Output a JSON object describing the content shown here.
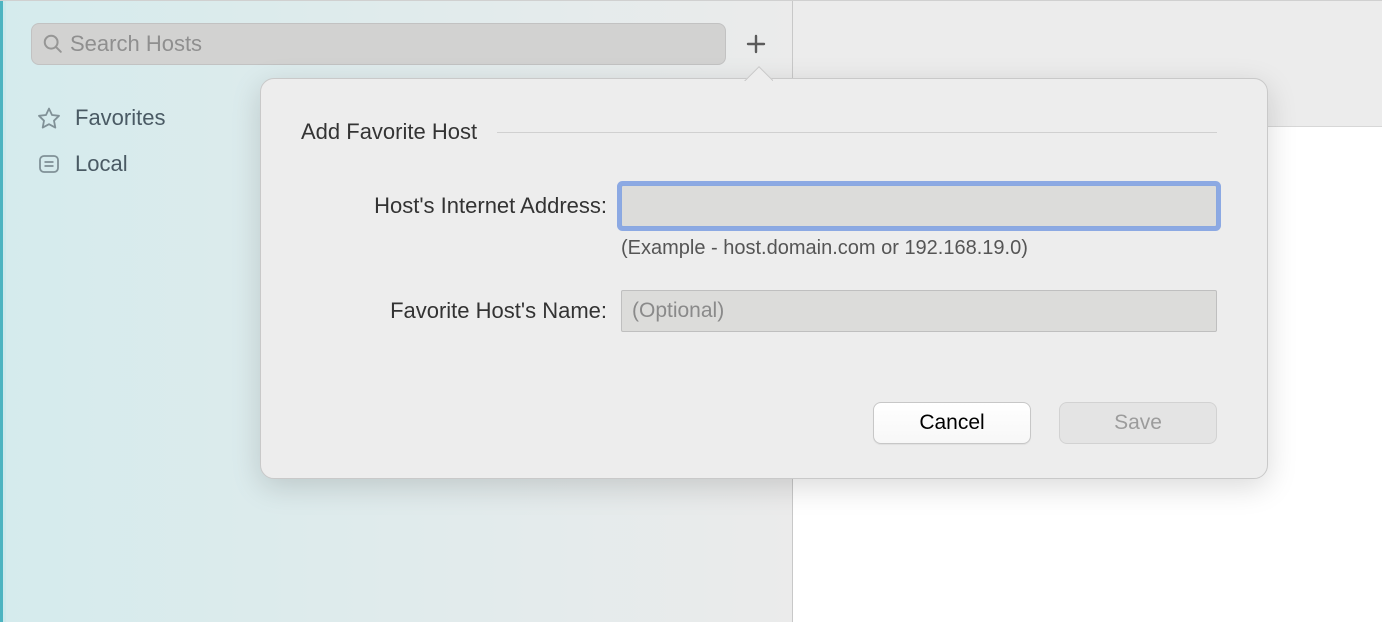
{
  "sidebar": {
    "search_placeholder": "Search Hosts",
    "items": [
      {
        "label": "Favorites"
      },
      {
        "label": "Local"
      }
    ]
  },
  "popover": {
    "title": "Add Favorite Host",
    "address_label": "Host's Internet Address:",
    "address_value": "",
    "address_hint": "(Example - host.domain.com or 192.168.19.0)",
    "name_label": "Favorite Host's Name:",
    "name_value": "",
    "name_placeholder": "(Optional)",
    "cancel_label": "Cancel",
    "save_label": "Save"
  }
}
